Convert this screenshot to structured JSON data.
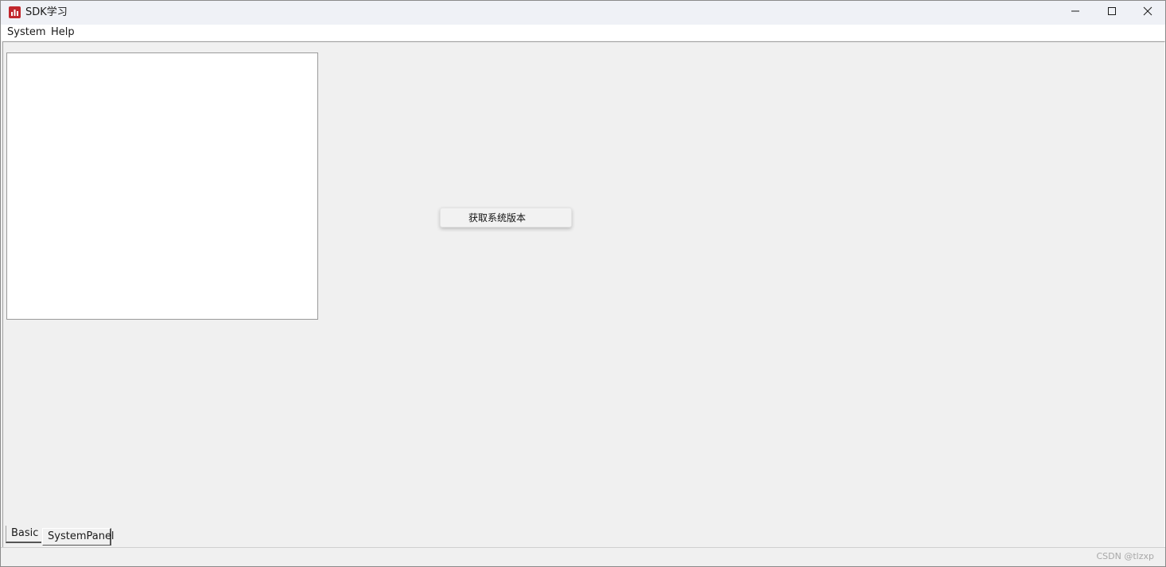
{
  "window": {
    "title": "SDK学习",
    "icon": "app-chart-icon",
    "accent_color": "#c1272d"
  },
  "menubar": {
    "items": [
      {
        "label": "System"
      },
      {
        "label": "Help"
      }
    ]
  },
  "main": {
    "action_button_label": "获取系统版本"
  },
  "tabs": [
    {
      "label": "Basic"
    },
    {
      "label": "SystemPanel"
    }
  ],
  "statusbar": {
    "watermark": "CSDN @tlzxp"
  }
}
